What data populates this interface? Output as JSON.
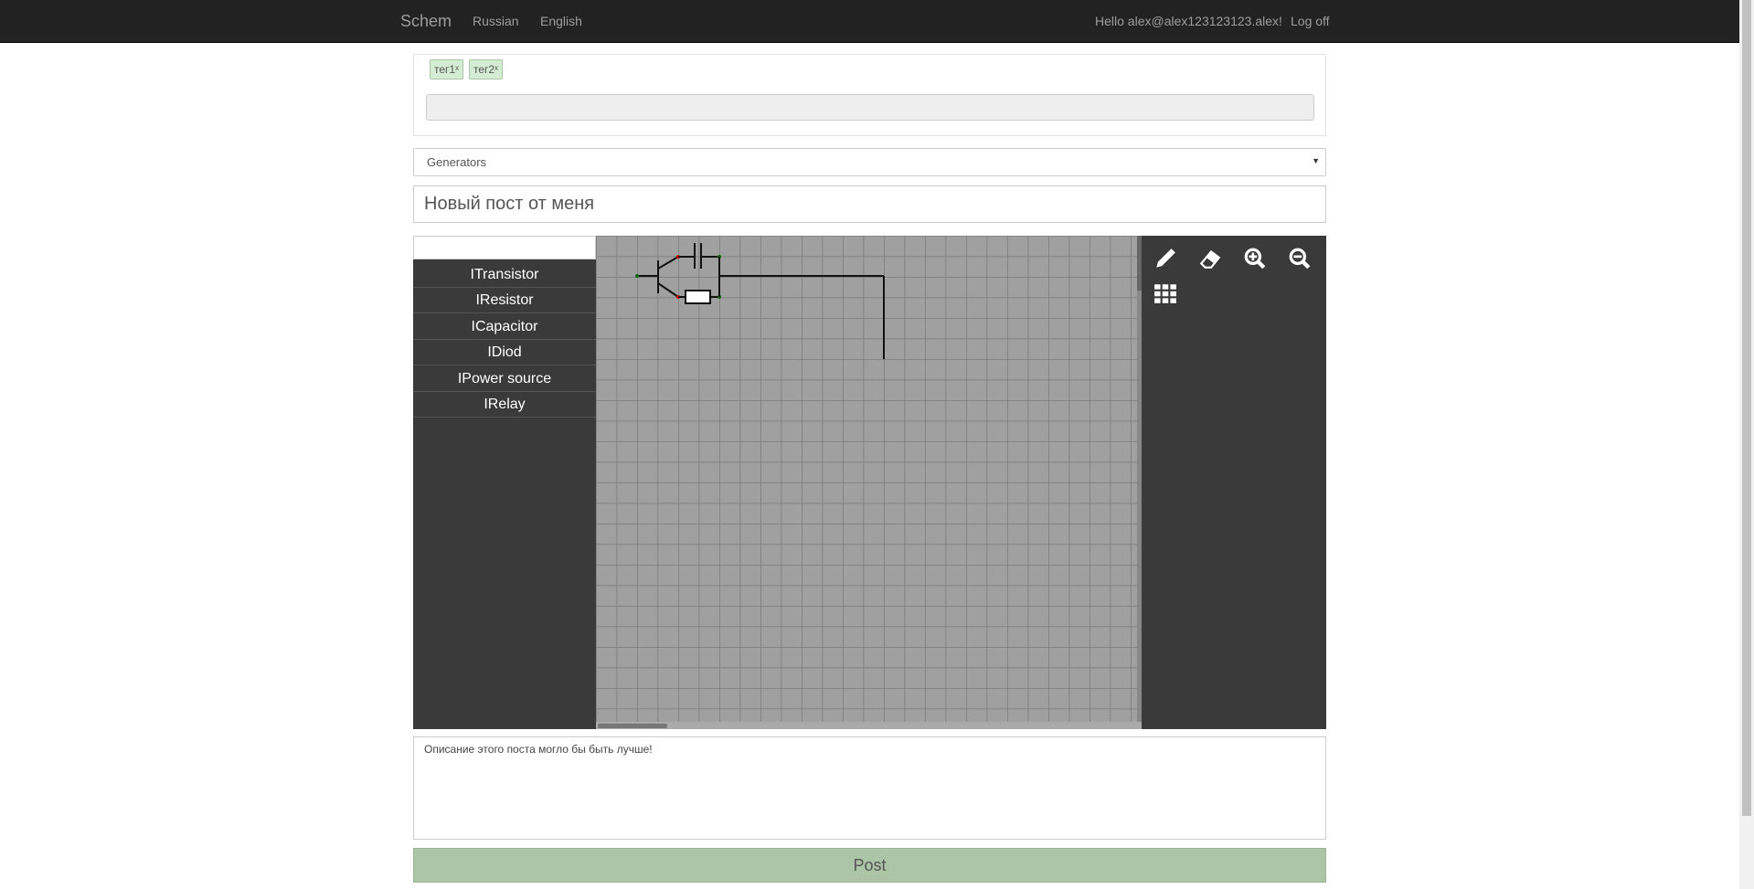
{
  "navbar": {
    "brand": "Schem",
    "links": [
      "Russian",
      "English"
    ],
    "greeting": "Hello alex@alex123123123.alex!",
    "logoff": "Log off"
  },
  "tags": {
    "items": [
      "тег1",
      "тег2"
    ],
    "input_value": ""
  },
  "category": {
    "selected": "Generators"
  },
  "post": {
    "title": "Новый пост от меня",
    "description": "Описание этого поста могло бы быть лучше!",
    "submit_label": "Post"
  },
  "palette": {
    "search_value": "",
    "items": [
      "ITransistor",
      "IResistor",
      "ICapacitor",
      "IDiod",
      "IPower source",
      "IRelay"
    ]
  },
  "toolbar": {
    "tools": [
      "pencil-icon",
      "eraser-icon",
      "zoom-in-icon",
      "zoom-out-icon",
      "grid-icon"
    ]
  },
  "colors": {
    "navbar": "#222222",
    "editor_bg": "#3a3a3a",
    "grid_bg": "#a0a0a0",
    "post_button": "#adc5a7",
    "tag_bg": "#d4ebd4"
  }
}
